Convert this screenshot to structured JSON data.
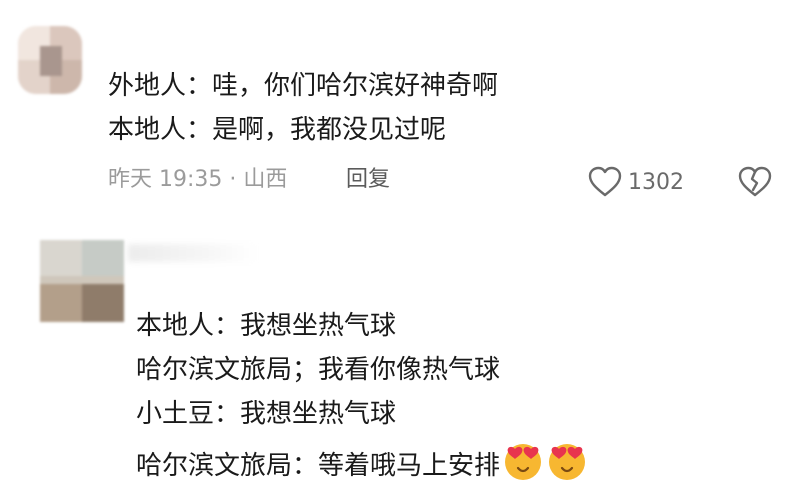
{
  "comment1": {
    "lines": [
      "外地人：哇，你们哈尔滨好神奇啊",
      "本地人：是啊，我都没见过呢"
    ],
    "time_location": "昨天 19:35 · 山西",
    "reply_label": "回复",
    "like_count": "1302"
  },
  "comment2": {
    "lines": [
      "本地人：我想坐热气球",
      "哈尔滨文旅局；我看你像热气球",
      "小土豆：我想坐热气球",
      "哈尔滨文旅局：等着哦马上安排"
    ],
    "emoji": [
      "heart-eyes-emoji",
      "heart-eyes-emoji"
    ]
  },
  "icons": {
    "like": "heart-outline-icon",
    "dislike": "broken-heart-icon"
  },
  "colors": {
    "text": "#1a1a1a",
    "meta": "#9b9b9b",
    "icon": "#6a6a6a",
    "emoji_face": "#f7b731",
    "emoji_heart": "#e8344e"
  }
}
